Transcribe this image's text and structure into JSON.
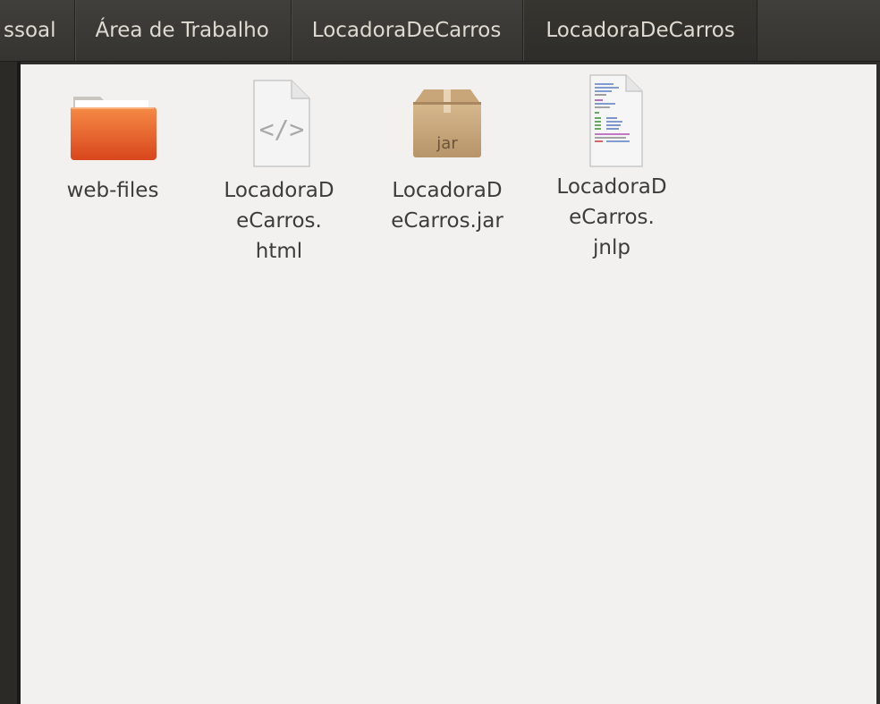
{
  "pathbar": {
    "crumbs": [
      {
        "label": "ssoal"
      },
      {
        "label": "Área de Trabalho"
      },
      {
        "label": "LocadoraDeCarros"
      },
      {
        "label": "LocadoraDeCarros"
      }
    ]
  },
  "files": [
    {
      "lines": [
        "web-files"
      ],
      "icon": "folder-icon",
      "color": "#e9592b"
    },
    {
      "lines": [
        "LocadoraD",
        "eCarros.",
        "html"
      ],
      "icon": "html-file-icon"
    },
    {
      "lines": [
        "LocadoraD",
        "eCarros.jar"
      ],
      "icon": "jar-package-icon",
      "badge": "jar"
    },
    {
      "lines": [
        "LocadoraD",
        "eCarros.",
        "jnlp"
      ],
      "icon": "jnlp-file-icon"
    }
  ]
}
